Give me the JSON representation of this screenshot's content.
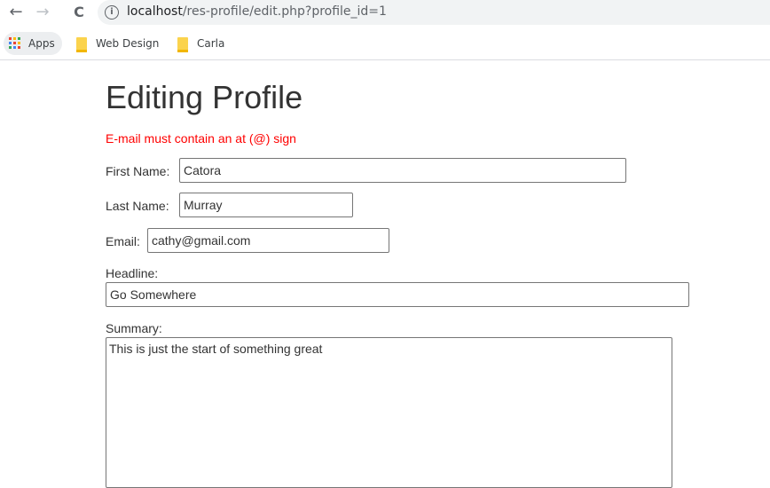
{
  "browser": {
    "back_icon": "←",
    "forward_icon": "→",
    "reload_icon": "C",
    "info_icon": "i",
    "url_host": "localhost",
    "url_path": "/res-profile/edit.php?profile_id=1",
    "bookmarks": [
      {
        "label": "Apps",
        "icon": "apps-grid-icon"
      },
      {
        "label": "Web Design",
        "icon": "folder-icon"
      },
      {
        "label": "Carla",
        "icon": "folder-icon"
      }
    ]
  },
  "page": {
    "title": "Editing Profile",
    "error_message": "E-mail must contain an at (@) sign",
    "first_name": {
      "label": "First Name:",
      "value": "Catora"
    },
    "last_name": {
      "label": "Last Name:",
      "value": "Murray"
    },
    "email": {
      "label": "Email:",
      "value": "cathy@gmail.com"
    },
    "headline": {
      "label": "Headline:",
      "value": "Go Somewhere"
    },
    "summary": {
      "label": "Summary:",
      "value": "This is just the start of something great"
    }
  },
  "colors": {
    "error": "#ff0000",
    "text": "#333333",
    "apps_dots": [
      "#ea4335",
      "#fbbc05",
      "#34a853",
      "#4285f4",
      "#ea4335",
      "#fbbc05",
      "#34a853",
      "#4285f4",
      "#ea4335"
    ]
  }
}
